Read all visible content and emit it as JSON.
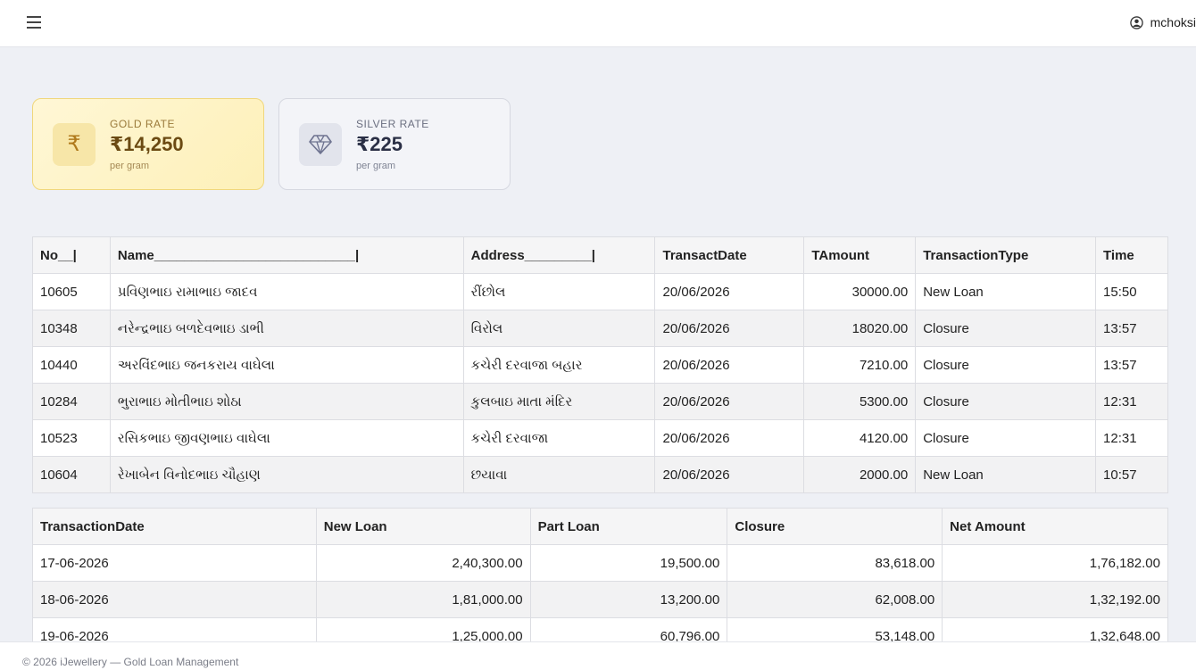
{
  "header": {
    "user_name": "mchoksi"
  },
  "rates": {
    "gold": {
      "label": "GOLD RATE",
      "value": "₹14,250",
      "unit": "per gram",
      "symbol": "₹"
    },
    "silver": {
      "label": "SILVER RATE",
      "value": "₹225",
      "unit": "per gram"
    }
  },
  "transactions": {
    "columns": [
      "No__|",
      "Name___________________________|",
      "Address_________|",
      "TransactDate",
      "TAmount",
      "TransactionType",
      "Time"
    ],
    "rows": [
      [
        "10605",
        "પ્રવિણભાઇ રામાભાઇ જાદવ",
        "રીંછોલ",
        "20/06/2026",
        "30000.00",
        "New Loan",
        "15:50"
      ],
      [
        "10348",
        "નરેન્દ્રભાઇ બળદેવભાઇ ડાભી",
        "વિરોલ",
        "20/06/2026",
        "18020.00",
        "Closure",
        "13:57"
      ],
      [
        "10440",
        "અરવિંદભાઇ જનકરાય વાઘેલા",
        "કચેરી દરવાજા બહાર",
        "20/06/2026",
        "7210.00",
        "Closure",
        "13:57"
      ],
      [
        "10284",
        "ભુરાભાઇ મોતીભાઇ શોઠા",
        "કુલબાઇ માતા મંદિર",
        "20/06/2026",
        "5300.00",
        "Closure",
        "12:31"
      ],
      [
        "10523",
        "રસિકભાઇ જીવણભાઇ વાઘેલા",
        "કચેરી દરવાજા",
        "20/06/2026",
        "4120.00",
        "Closure",
        "12:31"
      ],
      [
        "10604",
        "રેખાબેન વિનોદભાઇ ચૌહાણ",
        "છયાવા",
        "20/06/2026",
        "2000.00",
        "New Loan",
        "10:57"
      ]
    ]
  },
  "summary": {
    "columns": [
      "TransactionDate",
      "New Loan",
      "Part Loan",
      "Closure",
      "Net Amount"
    ],
    "rows": [
      [
        "17-06-2026",
        "2,40,300.00",
        "19,500.00",
        "83,618.00",
        "1,76,182.00"
      ],
      [
        "18-06-2026",
        "1,81,000.00",
        "13,200.00",
        "62,008.00",
        "1,32,192.00"
      ],
      [
        "19-06-2026",
        "1,25,000.00",
        "60,796.00",
        "53,148.00",
        "1,32,648.00"
      ]
    ]
  },
  "footer": {
    "text": "© 2026 iJewellery — Gold Loan Management"
  }
}
